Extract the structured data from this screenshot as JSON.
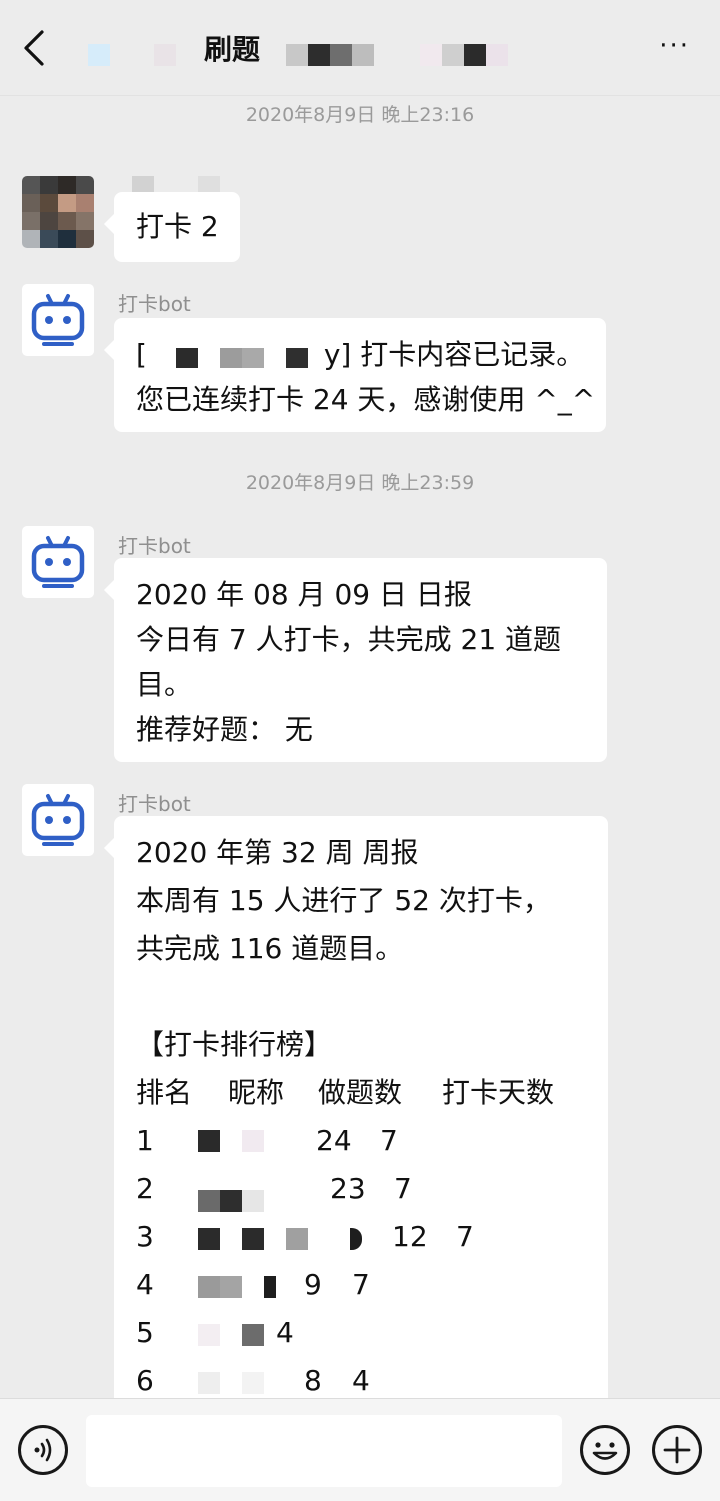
{
  "header": {
    "title": "刷题",
    "more_label": "···"
  },
  "messages": {
    "ts1": "2020年8月9日 晚上23:16",
    "ts2": "2020年8月9日 晚上23:59",
    "user_msg": "打卡 2",
    "bot_name": "打卡bot",
    "bot1_line1_prefix": "[",
    "bot1_line1_suffix": "y] 打卡内容已记录。",
    "bot1_line2": "您已连续打卡 24 天，感谢使用 ^_^",
    "bot2_line1": "2020 年 08 月 09 日 日报",
    "bot2_line2": "今日有 7 人打卡，共完成 21 道题",
    "bot2_line3": "目。",
    "bot2_line4": "推荐好题：  无",
    "bot3_line1": "2020 年第 32 周 周报",
    "bot3_line2": "本周有 15 人进行了 52 次打卡，",
    "bot3_line3": "共完成 116 道题目。",
    "bot3_board_title": "【打卡排行榜】",
    "bot3_headers": [
      "排名",
      "昵称",
      "做题数",
      "打卡天数"
    ],
    "ranking": [
      {
        "rank": "1",
        "count": "24",
        "days": "7"
      },
      {
        "rank": "2",
        "count": "23",
        "days": "7"
      },
      {
        "rank": "3",
        "count": "12",
        "days": "7"
      },
      {
        "rank": "4",
        "count": "9",
        "days": "7"
      },
      {
        "rank": "5",
        "count": "",
        "days": "4"
      },
      {
        "rank": "6",
        "count": "8",
        "days": "4"
      }
    ]
  },
  "colors": {
    "background": "#ececec",
    "bubble": "#ffffff",
    "bot_icon": "#2f5fc6",
    "timestamp": "#9a9a9a"
  },
  "icons": {
    "back": "back-arrow-icon",
    "more": "more-dots-icon",
    "bot": "robot-icon",
    "voice": "voice-icon",
    "emoji": "emoji-icon",
    "plus": "plus-icon"
  }
}
